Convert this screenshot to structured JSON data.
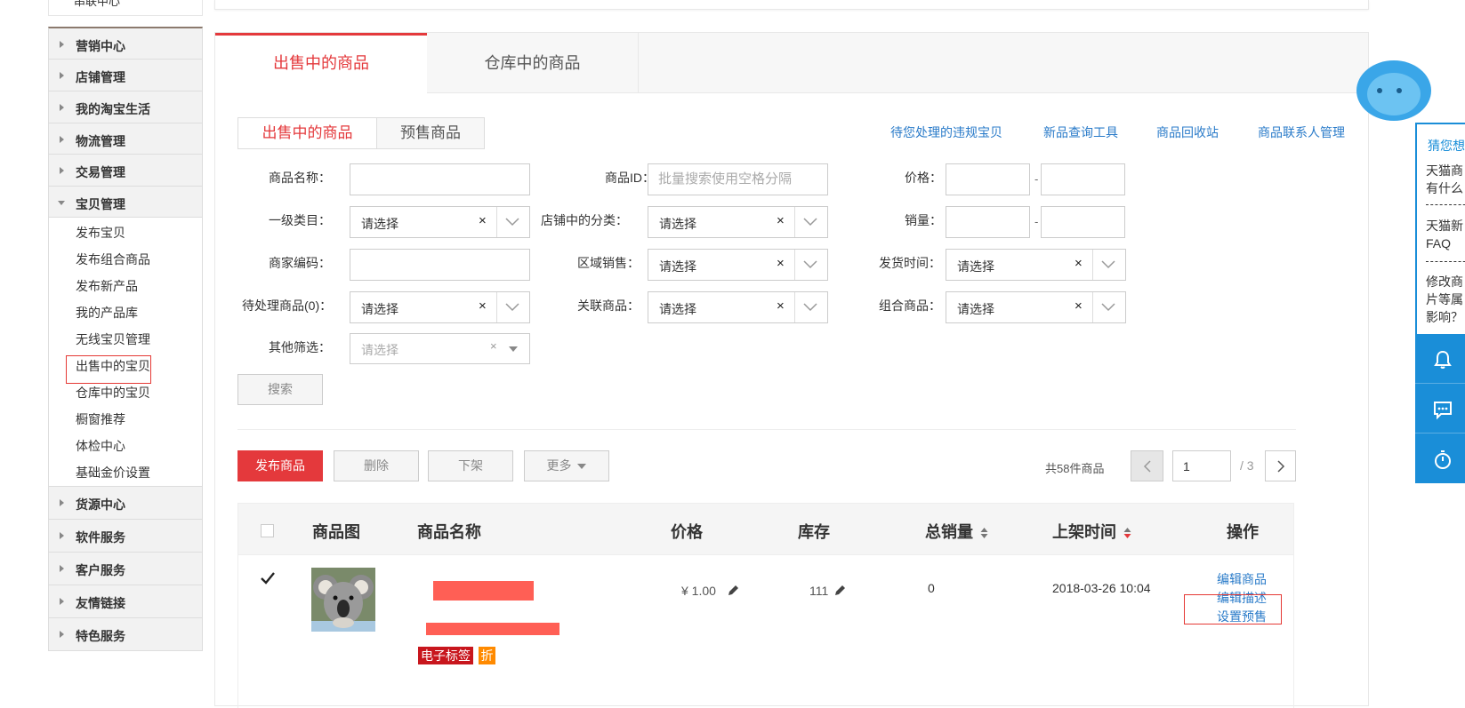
{
  "sidebar": {
    "top_cut_label": "串联中心",
    "groups": [
      {
        "label": "营销中心"
      },
      {
        "label": "店铺管理"
      },
      {
        "label": "我的淘宝生活"
      },
      {
        "label": "物流管理"
      },
      {
        "label": "交易管理"
      },
      {
        "label": "宝贝管理"
      }
    ],
    "items": [
      {
        "label": "发布宝贝"
      },
      {
        "label": "发布组合商品"
      },
      {
        "label": "发布新产品"
      },
      {
        "label": "我的产品库"
      },
      {
        "label": "无线宝贝管理"
      },
      {
        "label": "出售中的宝贝"
      },
      {
        "label": "仓库中的宝贝"
      },
      {
        "label": "橱窗推荐"
      },
      {
        "label": "体检中心"
      },
      {
        "label": "基础金价设置"
      }
    ],
    "groups_after": [
      {
        "label": "货源中心"
      },
      {
        "label": "软件服务"
      },
      {
        "label": "客户服务"
      },
      {
        "label": "友情链接"
      },
      {
        "label": "特色服务"
      }
    ]
  },
  "tabs": [
    {
      "label": "出售中的商品"
    },
    {
      "label": "仓库中的商品"
    }
  ],
  "subtabs": [
    {
      "label": "出售中的商品"
    },
    {
      "label": "预售商品"
    }
  ],
  "top_links": [
    {
      "label": "待您处理的违规宝贝"
    },
    {
      "label": "新品查询工具"
    },
    {
      "label": "商品回收站"
    },
    {
      "label": "商品联系人管理"
    }
  ],
  "filters": {
    "name_label": "商品名称：",
    "id_label": "商品ID：",
    "id_placeholder": "批量搜索使用空格分隔",
    "price_label": "价格：",
    "category_label": "一级类目：",
    "shop_category_label": "店铺中的分类：",
    "sales_label": "销量：",
    "merchant_code_label": "商家编码：",
    "region_label": "区域销售：",
    "ship_time_label": "发货时间：",
    "pending_label": "待处理商品(0)：",
    "related_label": "关联商品：",
    "combo_label": "组合商品：",
    "other_label": "其他筛选：",
    "select_default": "请选择",
    "range_dash": "-",
    "clear_mark": "×"
  },
  "actions": {
    "search": "搜索",
    "publish": "发布商品",
    "delete": "删除",
    "delist": "下架",
    "more": "更多"
  },
  "pager": {
    "total": "共58件商品",
    "current_page": "1",
    "total_pages": "/ 3"
  },
  "table": {
    "headers": [
      "商品图",
      "商品名称",
      "价格",
      "库存",
      "总销量",
      "上架时间",
      "操作"
    ],
    "rows": [
      {
        "checked": true,
        "price": "¥ 1.00",
        "stock": "111",
        "sales": "0",
        "listed_at": "2018-03-26 10:04",
        "tags": [
          "电子标签",
          "折"
        ],
        "ops": [
          "编辑商品",
          "编辑描述",
          "设置预售"
        ]
      }
    ]
  },
  "right_panel": {
    "title": "猜您想",
    "faqs": [
      {
        "lines": [
          "天猫商",
          "有什么"
        ]
      },
      {
        "lines": [
          "天猫新",
          "FAQ"
        ]
      },
      {
        "lines": [
          "修改商",
          "片等属",
          "影响？"
        ]
      }
    ]
  },
  "colors": {
    "accent_red": "#e4393c",
    "link_blue": "#2a7bc9",
    "panel_blue": "#1a8ed8"
  }
}
